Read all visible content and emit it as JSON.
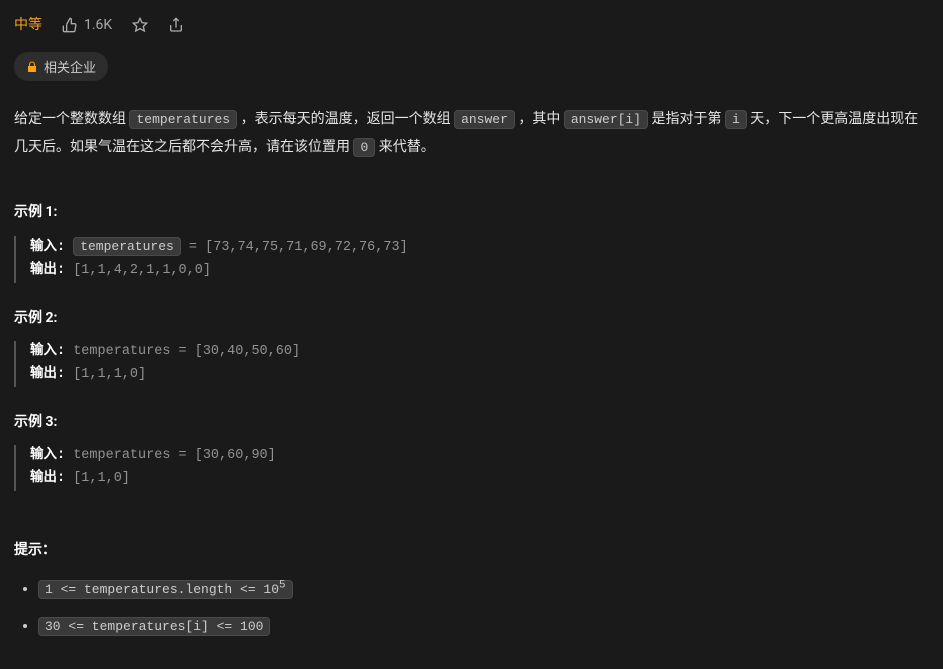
{
  "header": {
    "difficulty": "中等",
    "likes": "1.6K",
    "related_tag": "相关企业"
  },
  "description": {
    "part1": "给定一个整数数组 ",
    "code1": "temperatures",
    "part2": " ，表示每天的温度，返回一个数组 ",
    "code2": "answer",
    "part3": " ，其中 ",
    "code3": "answer[i]",
    "part4": " 是指对于第 ",
    "code4": "i",
    "part5": " 天，下一个更高温度出现在几天后。如果气温在这之后都不会升高，请在该位置用 ",
    "code5": "0",
    "part6": " 来代替。"
  },
  "examples": [
    {
      "title": "示例 1:",
      "input_label": "输入: ",
      "input_code": "temperatures",
      "input_rest": " = [73,74,75,71,69,72,76,73]",
      "output_label": "输出: ",
      "output_value": "[1,1,4,2,1,1,0,0]"
    },
    {
      "title": "示例 2:",
      "input_label": "输入:",
      "input_plain": " temperatures = [30,40,50,60]",
      "output_label": "输出: ",
      "output_value": "[1,1,1,0]"
    },
    {
      "title": "示例 3:",
      "input_label": "输入:",
      "input_plain": " temperatures = [30,60,90]",
      "output_label": "输出: ",
      "output_value": "[1,1,0]"
    }
  ],
  "hints": {
    "title": "提示：",
    "items": [
      {
        "pre": "1 <= temperatures.length <= 10",
        "sup": "5"
      },
      {
        "pre": "30 <= temperatures[i] <= 100",
        "sup": ""
      }
    ]
  }
}
